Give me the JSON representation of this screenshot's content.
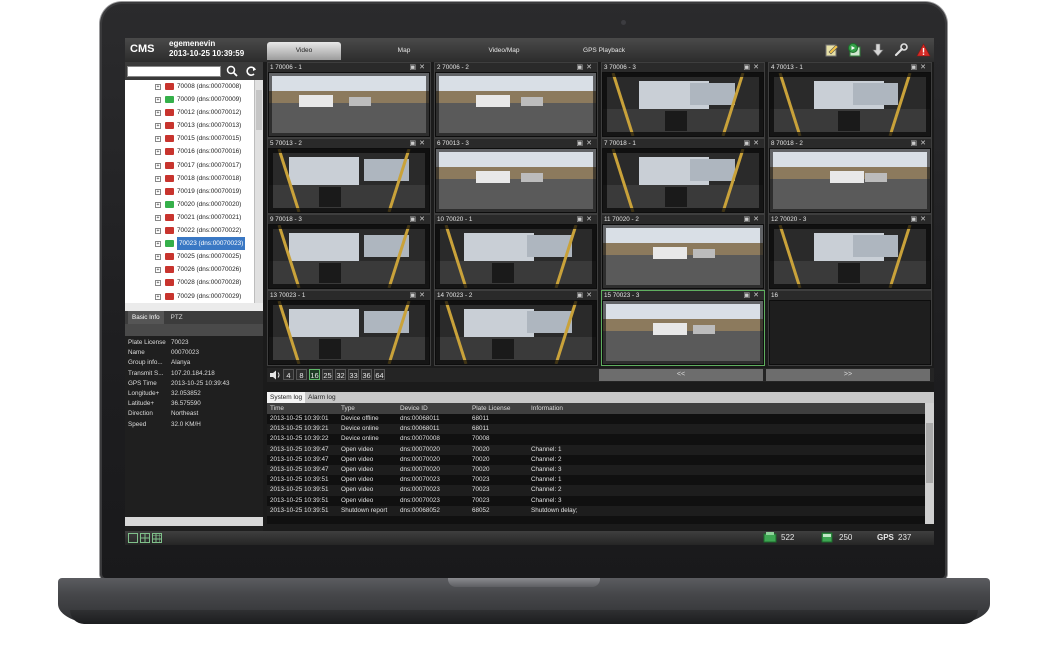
{
  "app": {
    "brand": "CMS",
    "user": "egemenevin",
    "datetime": "2013-10-25 10:39:59"
  },
  "tabs": [
    {
      "label": "Video",
      "active": true
    },
    {
      "label": "Map",
      "active": false
    },
    {
      "label": "Video/Map",
      "active": false
    },
    {
      "label": "GPS Playback",
      "active": false
    }
  ],
  "toolbar_icons": [
    "edit-icon",
    "refresh-video-icon",
    "download-icon",
    "wrench-icon",
    "alarm-icon"
  ],
  "search": {
    "placeholder": "",
    "value": ""
  },
  "device_tree": [
    {
      "label": "70008 (dns:00070008)",
      "status": "offline"
    },
    {
      "label": "70009 (dns:00070009)",
      "status": "online"
    },
    {
      "label": "70012 (dns:00070012)",
      "status": "offline"
    },
    {
      "label": "70013 (dns:00070013)",
      "status": "offline"
    },
    {
      "label": "70015 (dns:00070015)",
      "status": "offline"
    },
    {
      "label": "70016 (dns:00070016)",
      "status": "offline"
    },
    {
      "label": "70017 (dns:00070017)",
      "status": "offline"
    },
    {
      "label": "70018 (dns:00070018)",
      "status": "offline"
    },
    {
      "label": "70019 (dns:00070019)",
      "status": "offline"
    },
    {
      "label": "70020 (dns:00070020)",
      "status": "online"
    },
    {
      "label": "70021 (dns:00070021)",
      "status": "offline"
    },
    {
      "label": "70022 (dns:00070022)",
      "status": "offline"
    },
    {
      "label": "70023 (dns:00070023)",
      "status": "online",
      "selected": true
    },
    {
      "label": "70025 (dns:00070025)",
      "status": "offline"
    },
    {
      "label": "70026 (dns:00070026)",
      "status": "offline"
    },
    {
      "label": "70028 (dns:00070028)",
      "status": "offline"
    },
    {
      "label": "70029 (dns:00070029)",
      "status": "offline"
    }
  ],
  "info_tabs": [
    {
      "label": "Basic Info",
      "active": true
    },
    {
      "label": "PTZ",
      "active": false
    }
  ],
  "basic_info": [
    {
      "key": "Plate License",
      "value": "70023"
    },
    {
      "key": "Name",
      "value": "00070023"
    },
    {
      "key": "Group info...",
      "value": "Alanya"
    },
    {
      "key": "Transmit S...",
      "value": "107.20.184.218"
    },
    {
      "key": "GPS Time",
      "value": "2013-10-25 10:39:43"
    },
    {
      "key": "Longitude+",
      "value": "32.053852"
    },
    {
      "key": "Latitude+",
      "value": "36.575590"
    },
    {
      "key": "Direction",
      "value": "Northeast"
    },
    {
      "key": "Speed",
      "value": "32.0 KM/H"
    }
  ],
  "video_cells": [
    {
      "label": "1 70006 - 1"
    },
    {
      "label": "2 70006 - 2"
    },
    {
      "label": "3 70006 - 3"
    },
    {
      "label": "4 70013 - 1"
    },
    {
      "label": "5 70013 - 2"
    },
    {
      "label": "6 70013 - 3"
    },
    {
      "label": "7 70018 - 1"
    },
    {
      "label": "8 70018 - 2"
    },
    {
      "label": "9 70018 - 3"
    },
    {
      "label": "10 70020 - 1"
    },
    {
      "label": "11 70020 - 2"
    },
    {
      "label": "12 70020 - 3"
    },
    {
      "label": "13 70023 - 1"
    },
    {
      "label": "14 70023 - 2"
    },
    {
      "label": "15 70023 - 3",
      "active": true
    },
    {
      "label": "16",
      "empty": true
    }
  ],
  "layout_buttons": [
    {
      "label": "4"
    },
    {
      "label": "8"
    },
    {
      "label": "16",
      "active": true
    },
    {
      "label": "25"
    },
    {
      "label": "32"
    },
    {
      "label": "33"
    },
    {
      "label": "36"
    },
    {
      "label": "64"
    }
  ],
  "pager": {
    "prev": "<<",
    "next": ">>"
  },
  "log_tabs": [
    {
      "label": "System log",
      "active": true
    },
    {
      "label": "Alarm log",
      "active": false
    }
  ],
  "log_columns": [
    "Time",
    "Type",
    "Device ID",
    "Plate License",
    "Information"
  ],
  "log_rows": [
    [
      "2013-10-25 10:39:01",
      "Device offline",
      "dns:00068011",
      "68011",
      ""
    ],
    [
      "2013-10-25 10:39:21",
      "Device online",
      "dns:00068011",
      "68011",
      ""
    ],
    [
      "2013-10-25 10:39:22",
      "Device online",
      "dns:00070008",
      "70008",
      ""
    ],
    [
      "2013-10-25 10:39:47",
      "Open video",
      "dns:00070020",
      "70020",
      "Channel: 1"
    ],
    [
      "2013-10-25 10:39:47",
      "Open video",
      "dns:00070020",
      "70020",
      "Channel: 2"
    ],
    [
      "2013-10-25 10:39:47",
      "Open video",
      "dns:00070020",
      "70020",
      "Channel: 3"
    ],
    [
      "2013-10-25 10:39:51",
      "Open video",
      "dns:00070023",
      "70023",
      "Channel: 1"
    ],
    [
      "2013-10-25 10:39:51",
      "Open video",
      "dns:00070023",
      "70023",
      "Channel: 2"
    ],
    [
      "2013-10-25 10:39:51",
      "Open video",
      "dns:00070023",
      "70023",
      "Channel: 3"
    ],
    [
      "2013-10-25 10:39:51",
      "Shutdown report",
      "dns:00068052",
      "68052",
      "Shutdown delay;"
    ]
  ],
  "status": {
    "count_a": "522",
    "count_b": "250",
    "gps_label": "GPS",
    "gps_count": "237"
  },
  "colors": {
    "online": "#35b04a",
    "offline": "#c8342e",
    "selected": "#3a78c4",
    "accent_green": "#5fb86a"
  }
}
